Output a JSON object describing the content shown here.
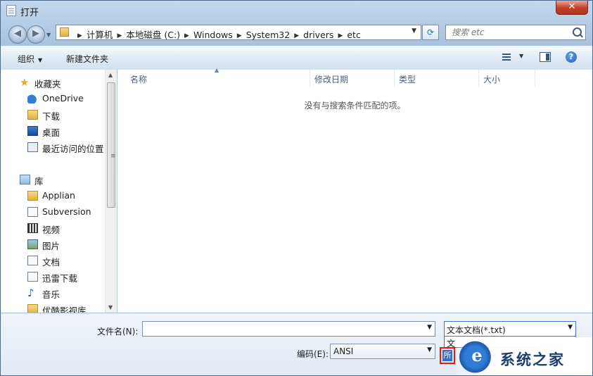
{
  "window": {
    "title": "打开",
    "close_label": "✕"
  },
  "address": {
    "crumbs": [
      "计算机",
      "本地磁盘 (C:)",
      "Windows",
      "System32",
      "drivers",
      "etc"
    ],
    "separator": "▶"
  },
  "search": {
    "placeholder": "搜索 etc"
  },
  "toolbar": {
    "organize_label": "组织",
    "new_folder_label": "新建文件夹",
    "help_label": "?"
  },
  "nav": {
    "favorites": [
      {
        "label": "收藏夹",
        "icon": "star-icon"
      },
      {
        "label": "OneDrive",
        "icon": "cloud-icon"
      },
      {
        "label": "下载",
        "icon": "download-folder-icon"
      },
      {
        "label": "桌面",
        "icon": "desktop-icon"
      },
      {
        "label": "最近访问的位置",
        "icon": "recent-places-icon"
      }
    ],
    "libraries": [
      {
        "label": "库",
        "icon": "library-icon"
      },
      {
        "label": "Applian",
        "icon": "folder-icon"
      },
      {
        "label": "Subversion",
        "icon": "document-library-icon"
      },
      {
        "label": "视频",
        "icon": "video-library-icon"
      },
      {
        "label": "图片",
        "icon": "picture-library-icon"
      },
      {
        "label": "文档",
        "icon": "document-library-icon"
      },
      {
        "label": "迅雷下载",
        "icon": "document-library-icon"
      },
      {
        "label": "音乐",
        "icon": "music-library-icon"
      },
      {
        "label": "优酷影视库",
        "icon": "folder-icon"
      }
    ]
  },
  "columns": [
    "名称",
    "修改日期",
    "类型",
    "大小"
  ],
  "empty_message": "没有与搜索条件匹配的项。",
  "bottom": {
    "filename_label": "文件名(N):",
    "filename_value": "",
    "filetype_value": "文本文档(*.txt)",
    "dropdown_partial_item": "文",
    "encoding_label": "编码(E):",
    "encoding_value": "ANSI",
    "highlighted_partial": "所"
  },
  "watermark": {
    "text": "系统之家",
    "logo_letter": "e"
  },
  "colors": {
    "accent": "#3b79c8",
    "highlight_box": "#e21b1b",
    "titlebar": "#c4d8ec"
  }
}
